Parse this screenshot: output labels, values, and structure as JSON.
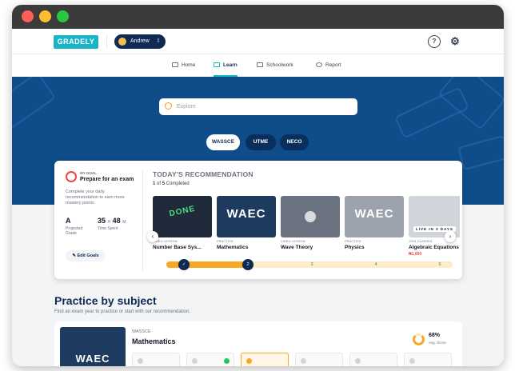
{
  "app": {
    "logo": "GRADELY"
  },
  "user": {
    "name": "Andrew"
  },
  "nav": {
    "tabs": [
      {
        "label": "Home",
        "icon": "monitor-icon"
      },
      {
        "label": "Learn",
        "icon": "book-icon"
      },
      {
        "label": "Schoolwork",
        "icon": "box-icon"
      },
      {
        "label": "Report",
        "icon": "pie-chart-icon"
      }
    ],
    "active": "Learn"
  },
  "search": {
    "placeholder": "Explore"
  },
  "exams": [
    "WASSCE",
    "UTME",
    "NECO"
  ],
  "goal": {
    "small": "MY GOAL",
    "title": "Prepare for an exam",
    "description": "Complete your daily recommendation to earn more mastery points",
    "grade_value": "A",
    "grade_label": "Projected Grade",
    "time_hours": "35",
    "time_minutes": "48",
    "time_label": "Time Spent",
    "edit_label": "Edit Goals"
  },
  "recommendation": {
    "title": "TODAY'S RECOMMENDATION",
    "completed": "1",
    "total": "5",
    "completed_suffix": "Completed",
    "lessons": [
      {
        "kind": "VIDEO LESSON",
        "name": "Number Base Sys...",
        "thumb_text": "DONE"
      },
      {
        "kind": "PRACTICE",
        "name": "Mathematics",
        "thumb_text": "WAEC"
      },
      {
        "kind": "VIDEO LESSON",
        "name": "Wave Theory",
        "thumb_text": ""
      },
      {
        "kind": "PRACTICE",
        "name": "Physics",
        "thumb_text": "WAEC"
      },
      {
        "kind": "JOIN CLASSES",
        "name": "Algebraic Equations",
        "thumb_text": "LIVE IN 3 DAYS",
        "price": "₦1,000"
      }
    ],
    "steps": [
      "✓",
      "2",
      "3",
      "4",
      "5"
    ],
    "progress_fraction": 0.3
  },
  "practice": {
    "title": "Practice by subject",
    "subtitle": "Find an exam year to practice or start with our recommendation.",
    "subject": {
      "exam": "WASSCE",
      "name": "Mathematics",
      "score": "68%",
      "score_label": "Avg. Score"
    }
  },
  "colors": {
    "brand": "#17b5c6",
    "navy": "#0e2a55",
    "hero": "#0f4c8a",
    "accent": "#f9a825"
  }
}
